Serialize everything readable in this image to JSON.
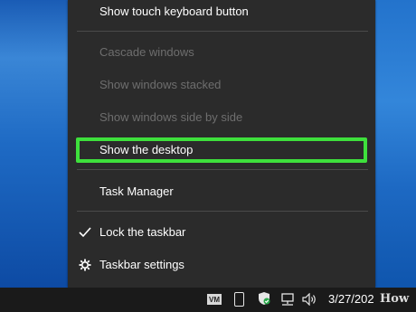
{
  "menu": {
    "items": [
      {
        "label": "Show touch keyboard button",
        "enabled": true
      },
      {
        "label": "Cascade windows",
        "enabled": false
      },
      {
        "label": "Show windows stacked",
        "enabled": false
      },
      {
        "label": "Show windows side by side",
        "enabled": false
      },
      {
        "label": "Show the desktop",
        "enabled": true,
        "highlighted": true
      },
      {
        "label": "Task Manager",
        "enabled": true
      },
      {
        "label": "Lock the taskbar",
        "enabled": true,
        "checked": true
      },
      {
        "label": "Taskbar settings",
        "enabled": true
      }
    ],
    "icons": {
      "checkmark": "checkmark-icon",
      "settings": "gear-icon"
    },
    "highlight_color": "#3ee03c"
  },
  "taskbar": {
    "tray": {
      "vm_badge": "VM",
      "icons": [
        "vm-icon",
        "phone-icon",
        "security-shield-icon",
        "network-icon",
        "volume-icon"
      ],
      "clock_text": "3/27/202"
    }
  },
  "watermark": {
    "text": "How"
  }
}
